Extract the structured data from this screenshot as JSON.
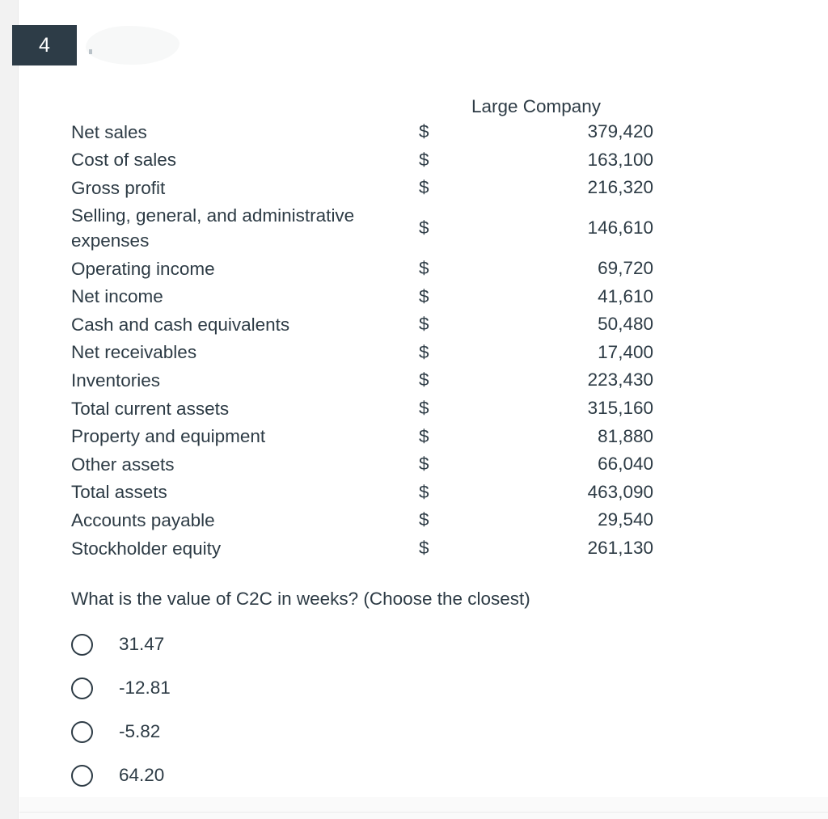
{
  "question": {
    "number": "4",
    "prompt": "What is the value of C2C in weeks? (Choose the closest)",
    "options": [
      {
        "label": "31.47"
      },
      {
        "label": "-12.81"
      },
      {
        "label": "-5.82"
      },
      {
        "label": "64.20"
      }
    ]
  },
  "table": {
    "company_header": "Large Company",
    "currency_symbol": "$",
    "rows": [
      {
        "label": "Net sales",
        "currency": "$",
        "value": "379,420"
      },
      {
        "label": "Cost of sales",
        "currency": "$",
        "value": "163,100"
      },
      {
        "label": "Gross profit",
        "currency": "$",
        "value": "216,320"
      },
      {
        "label": "Selling, general, and administrative expenses",
        "currency": "$",
        "value": "146,610"
      },
      {
        "label": "Operating income",
        "currency": "$",
        "value": "69,720"
      },
      {
        "label": "Net income",
        "currency": "$",
        "value": "41,610"
      },
      {
        "label": "Cash and cash equivalents",
        "currency": "$",
        "value": "50,480"
      },
      {
        "label": "Net receivables",
        "currency": "$",
        "value": "17,400"
      },
      {
        "label": "Inventories",
        "currency": "$",
        "value": "223,430"
      },
      {
        "label": "Total current assets",
        "currency": "$",
        "value": "315,160"
      },
      {
        "label": "Property and equipment",
        "currency": "$",
        "value": "81,880"
      },
      {
        "label": "Other assets",
        "currency": "$",
        "value": "66,040"
      },
      {
        "label": "Total assets",
        "currency": "$",
        "value": "463,090"
      },
      {
        "label": "Accounts payable",
        "currency": "$",
        "value": "29,540"
      },
      {
        "label": "Stockholder equity",
        "currency": "$",
        "value": "261,130"
      }
    ]
  },
  "colors": {
    "badge_background": "#2d3c47",
    "text": "#2d3b45",
    "gutter": "#f2f2f2",
    "redaction": "#f7f8f8"
  }
}
